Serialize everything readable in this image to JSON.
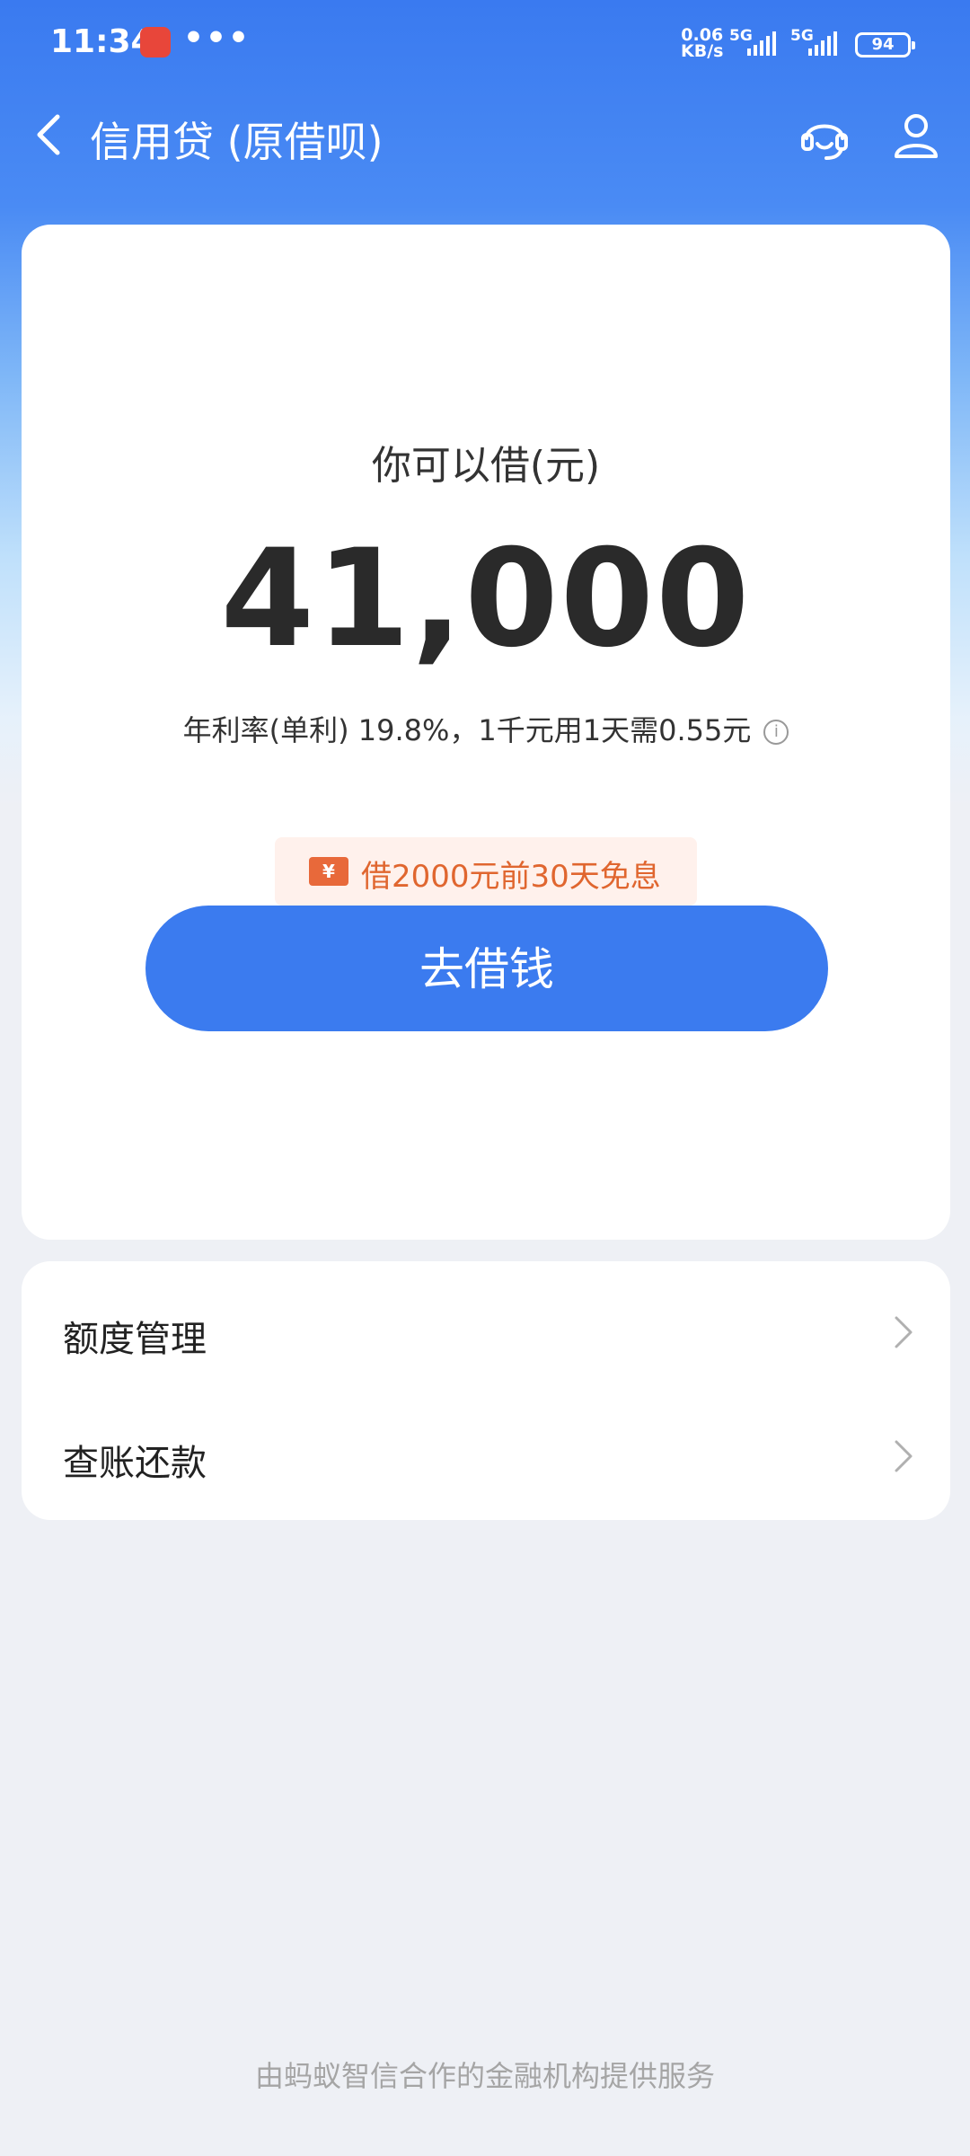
{
  "status_bar": {
    "time": "11:34",
    "dots": "•••",
    "net_speed_value": "0.06",
    "net_speed_unit": "KB/s",
    "signal1_label": "5G",
    "signal2_label": "5G",
    "battery": "94"
  },
  "nav": {
    "title": "信用贷 (原借呗)"
  },
  "loan": {
    "subtitle": "你可以借(元)",
    "amount": "41,000",
    "rate_text": "年利率(单利) 19.8%，1千元用1天需0.55元",
    "promo_icon": "¥",
    "promo_text": "借2000元前30天免息",
    "button_label": "去借钱"
  },
  "menu": {
    "items": [
      {
        "label": "额度管理"
      },
      {
        "label": "查账还款"
      }
    ]
  },
  "footer": {
    "text": "由蚂蚁智信合作的金融机构提供服务"
  },
  "colors": {
    "primary": "#3b7bef",
    "promo": "#e0662f",
    "background": "#eef0f5"
  }
}
